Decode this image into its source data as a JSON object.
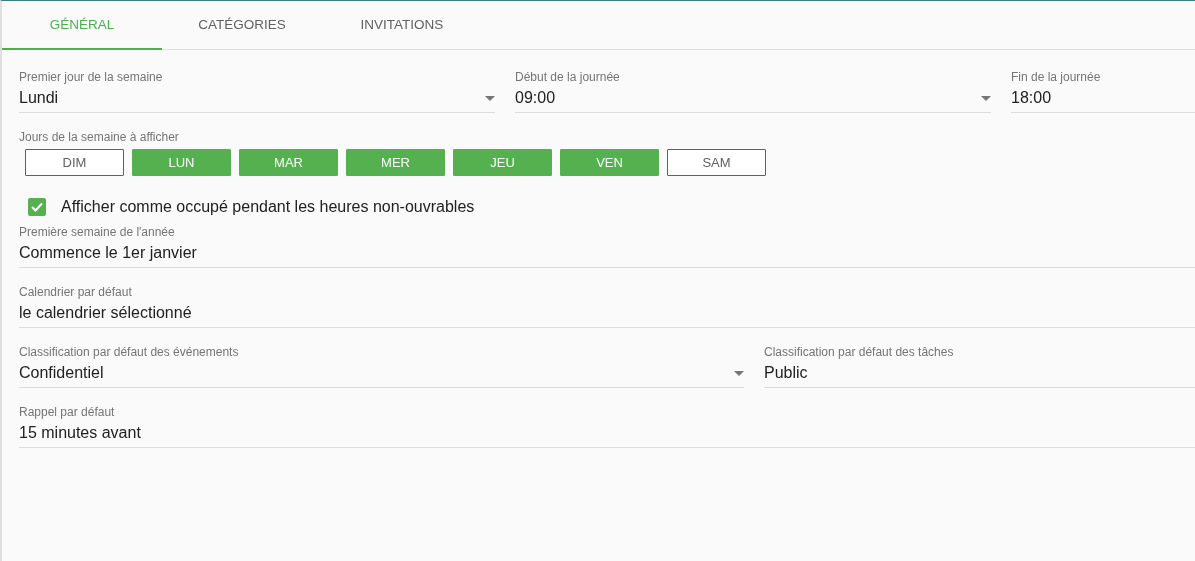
{
  "tabs": [
    {
      "label": "GÉNÉRAL",
      "selected": true
    },
    {
      "label": "CATÉGORIES",
      "selected": false
    },
    {
      "label": "INVITATIONS",
      "selected": false
    }
  ],
  "top_fields": [
    {
      "label": "Premier jour de la semaine",
      "value": "Lundi",
      "dropdown": true
    },
    {
      "label": "Début de la journée",
      "value": "09:00",
      "dropdown": true
    },
    {
      "label": "Fin de la journée",
      "value": "18:00",
      "dropdown": false
    }
  ],
  "weekdays": {
    "label": "Jours de la semaine à afficher",
    "days": [
      {
        "label": "DIM",
        "selected": false
      },
      {
        "label": "LUN",
        "selected": true
      },
      {
        "label": "MAR",
        "selected": true
      },
      {
        "label": "MER",
        "selected": true
      },
      {
        "label": "JEU",
        "selected": true
      },
      {
        "label": "VEN",
        "selected": true
      },
      {
        "label": "SAM",
        "selected": false
      }
    ]
  },
  "busy_option": {
    "label": "Afficher comme occupé pendant les heures non-ouvrables",
    "checked": true
  },
  "field_rows": [
    [
      {
        "label": "Première semaine de l'année",
        "value": "Commence le 1er janvier",
        "dropdown": false
      }
    ],
    [
      {
        "label": "Calendrier par défaut",
        "value": "le calendrier sélectionné",
        "dropdown": false
      }
    ],
    [
      {
        "label": "Classification par défaut des événements",
        "value": "Confidentiel",
        "dropdown": true
      },
      {
        "label": "Classification par défaut des tâches",
        "value": "Public",
        "dropdown": false
      }
    ],
    [
      {
        "label": "Rappel par défaut",
        "value": "15 minutes avant",
        "dropdown": false
      }
    ]
  ]
}
